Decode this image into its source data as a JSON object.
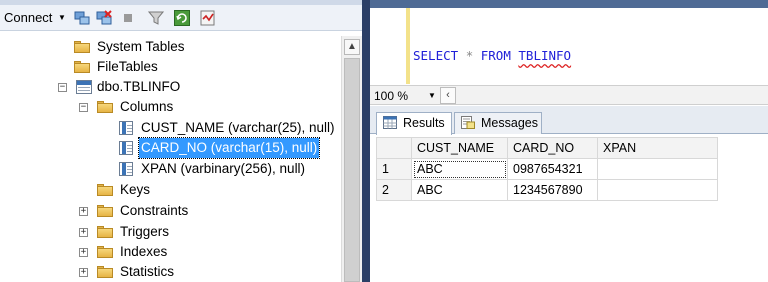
{
  "toolbar": {
    "connect_label": "Connect",
    "icons": [
      "connect-object-explorer-icon",
      "disconnect-icon",
      "stop-icon",
      "filter-icon",
      "refresh-icon",
      "activity-monitor-icon"
    ]
  },
  "tree": {
    "system_tables": "System Tables",
    "file_tables": "FileTables",
    "table_name": "dbo.TBLINFO",
    "columns_folder": "Columns",
    "columns": [
      {
        "label": "CUST_NAME (varchar(25), null)"
      },
      {
        "label": "CARD_NO (varchar(15), null)"
      },
      {
        "label": "XPAN (varbinary(256), null)"
      }
    ],
    "folders": [
      "Keys",
      "Constraints",
      "Triggers",
      "Indexes",
      "Statistics"
    ]
  },
  "editor": {
    "kw_select": "SELECT",
    "star": "*",
    "kw_from": "FROM",
    "table": "TBLINFO"
  },
  "zoom": {
    "value": "100 %"
  },
  "results": {
    "tab_results": "Results",
    "tab_messages": "Messages",
    "columns": [
      "CUST_NAME",
      "CARD_NO",
      "XPAN"
    ],
    "rows": [
      {
        "num": "1",
        "cust_name": "ABC",
        "card_no": "0987654321",
        "xpan": ""
      },
      {
        "num": "2",
        "cust_name": "ABC",
        "card_no": "1234567890",
        "xpan": ""
      }
    ]
  },
  "colors": {
    "selection": "#3399ff",
    "keyword": "#2020d8",
    "splitter": "#2b3f66"
  }
}
